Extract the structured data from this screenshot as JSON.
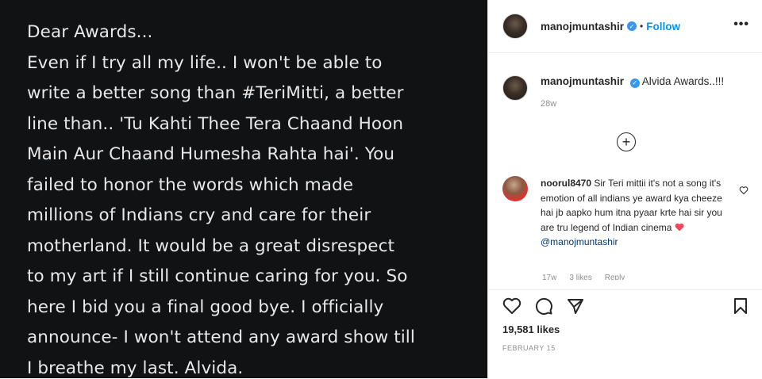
{
  "post": {
    "image_text": "Dear Awards...\nEven if I try all my life.. I won't be able to\nwrite a better song than #TeriMitti, a better\nline than.. 'Tu Kahti Thee Tera Chaand Hoon\nMain Aur Chaand Humesha Rahta hai'. You\nfailed to honor the words which made\nmillions of Indians cry and care for their\nmotherland. It would be a great disrespect\nto my art if I still continue caring for you. So\nhere I bid you a final good bye. I officially\nannounce- I won't attend any award show till\nI breathe my last. Alvida."
  },
  "header": {
    "username": "manojmuntashir",
    "separator": "•",
    "follow": "Follow",
    "more": "•••"
  },
  "caption": {
    "username": "manojmuntashir",
    "text": "Alvida Awards..!!!",
    "time": "28w"
  },
  "comment": {
    "username": "noorul8470",
    "text": "Sir Teri mittii it's not a song it's emotion of all indians ye award kya cheeze hai jb aapko hum itna pyaar krte hai sir you are tru legend of Indian cinema",
    "mention": "@manojmuntashir",
    "meta": [
      "17w",
      "3 likes",
      "Reply"
    ]
  },
  "footer": {
    "likes": "19,581 likes",
    "date": "FEBRUARY 15"
  },
  "colors": {
    "verified": "#3897f0",
    "follow": "#0095f6",
    "heart": "#ed4956"
  }
}
